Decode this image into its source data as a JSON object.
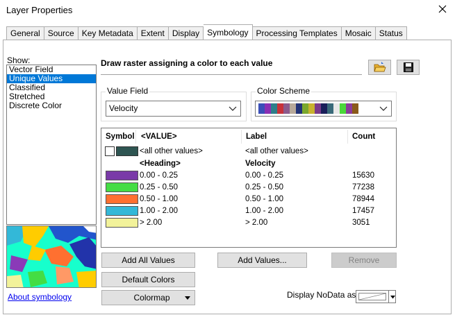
{
  "window": {
    "title": "Layer Properties"
  },
  "tabs": [
    {
      "label": "General"
    },
    {
      "label": "Source"
    },
    {
      "label": "Key Metadata"
    },
    {
      "label": "Extent"
    },
    {
      "label": "Display"
    },
    {
      "label": "Symbology",
      "active": true
    },
    {
      "label": "Processing Templates"
    },
    {
      "label": "Mosaic"
    },
    {
      "label": "Status"
    }
  ],
  "show": {
    "label": "Show:",
    "items": [
      "Vector Field",
      "Unique Values",
      "Classified",
      "Stretched",
      "Discrete Color"
    ],
    "selected": "Unique Values"
  },
  "description": "Draw raster assigning a color to each value",
  "value_field": {
    "label": "Value Field",
    "value": "Velocity"
  },
  "color_scheme": {
    "label": "Color Scheme",
    "colors": [
      "#3a4fb8",
      "#8a2fb3",
      "#2e7f8a",
      "#c8323a",
      "#8b5a8c",
      "#b7a99a",
      "#223377",
      "#7aa82e",
      "#c8b22e",
      "#7a3a8a",
      "#1a1f5a",
      "#3a6a7a",
      "#e8e8e8",
      "#4ad83a",
      "#8a3a9a",
      "#8a5a1a"
    ]
  },
  "table": {
    "headers": {
      "symbol": "Symbol",
      "value": "<VALUE>",
      "label": "Label",
      "count": "Count"
    },
    "all_other": {
      "value": "<all other values>",
      "label": "<all other values>",
      "color": "#2e5552"
    },
    "heading": {
      "value": "<Heading>",
      "label": "Velocity"
    },
    "rows": [
      {
        "value": "0.00 - 0.25",
        "label": "0.00 - 0.25",
        "count": "15630",
        "color": "#7a3aa8"
      },
      {
        "value": "0.25 - 0.50",
        "label": "0.25 - 0.50",
        "count": "77238",
        "color": "#44dd44"
      },
      {
        "value": "0.50 - 1.00",
        "label": "0.50 - 1.00",
        "count": "78944",
        "color": "#ff7030"
      },
      {
        "value": "1.00 - 2.00",
        "label": "1.00 - 2.00",
        "count": "17457",
        "color": "#33b8d8"
      },
      {
        "value": "> 2.00",
        "label": "> 2.00",
        "count": "3051",
        "color": "#f2f29a"
      }
    ]
  },
  "buttons": {
    "add_all": "Add All Values",
    "add_values": "Add Values...",
    "remove": "Remove",
    "default_colors": "Default Colors",
    "colormap": "Colormap"
  },
  "nodata": {
    "label": "Display NoData as"
  },
  "about_link": "About symbology"
}
